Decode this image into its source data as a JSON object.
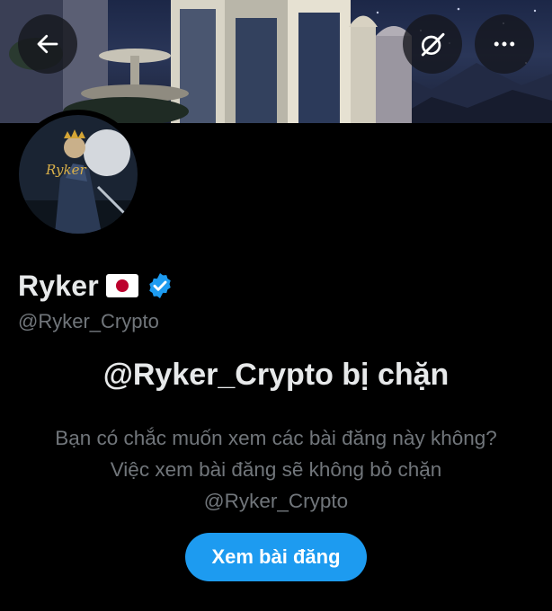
{
  "header": {
    "back_icon": "arrow-left-icon",
    "grok_icon": "grok-icon",
    "more_icon": "more-horizontal-icon"
  },
  "profile": {
    "display_name": "Ryker",
    "flag": "japan-flag",
    "verified": true,
    "handle": "@Ryker_Crypto",
    "avatar_text": "Ryker"
  },
  "blocked_notice": {
    "title": "@Ryker_Crypto bị chặn",
    "line1": "Bạn có chắc muốn xem các bài đăng này không?",
    "line2": "Việc xem bài đăng sẽ không bỏ chặn",
    "line3": "@Ryker_Crypto",
    "button_label": "Xem bài đăng"
  },
  "colors": {
    "accent": "#1d9bf0",
    "background": "#000000",
    "secondary_text": "#71767b",
    "primary_text": "#e7e9ea"
  }
}
